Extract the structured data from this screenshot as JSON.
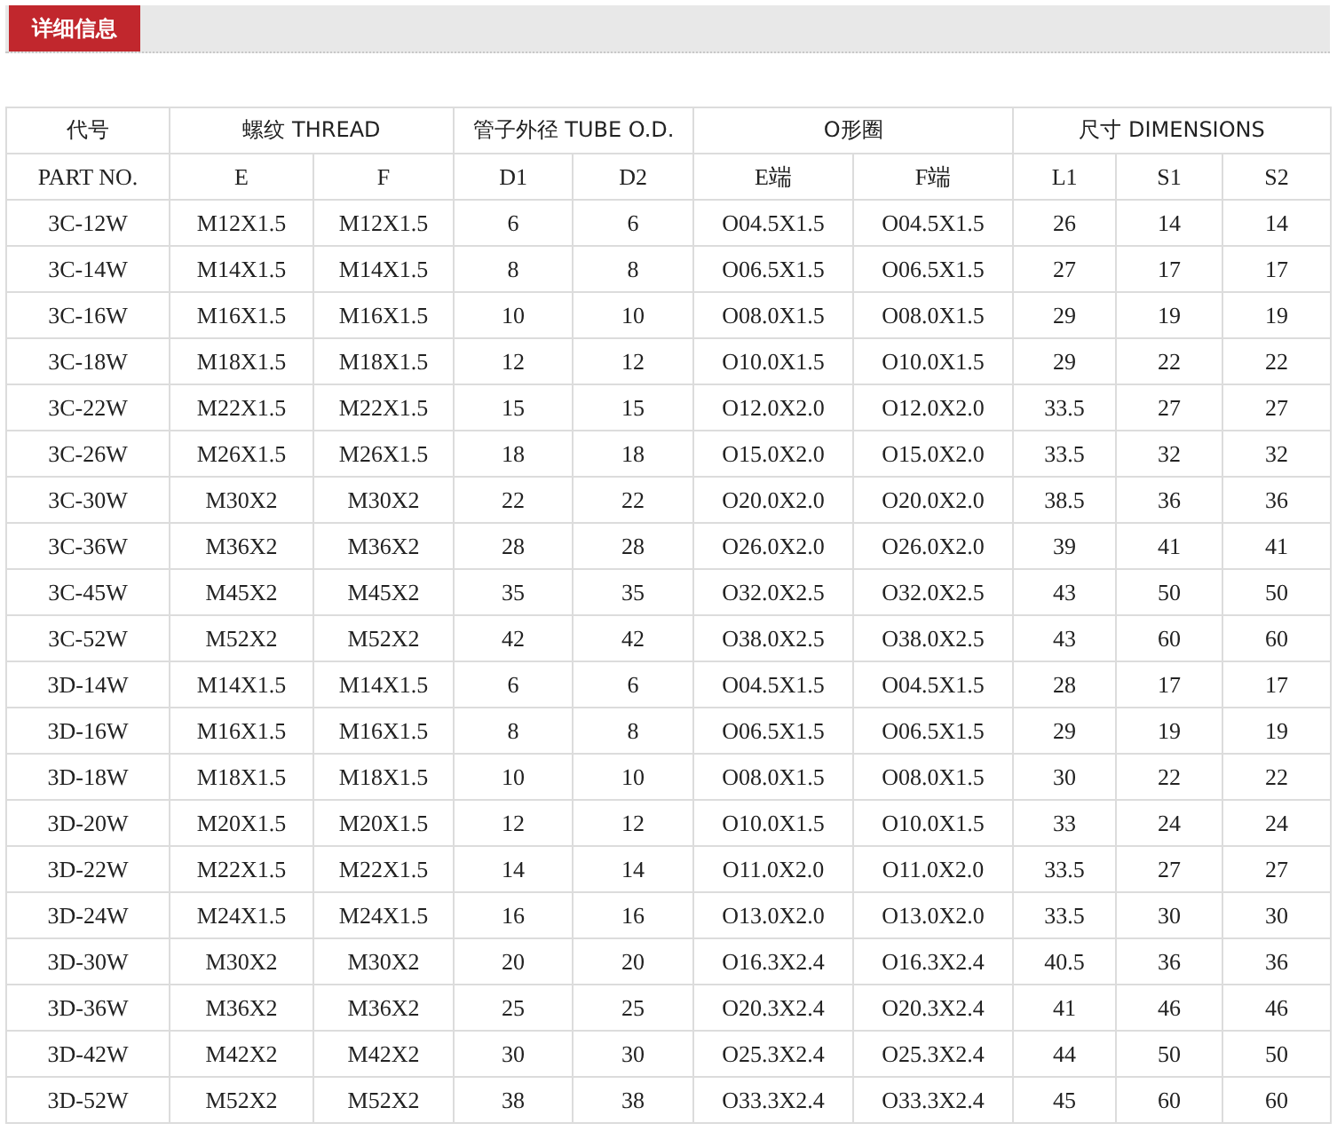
{
  "tabs": [
    {
      "label": "详细信息",
      "selected": true
    }
  ],
  "table": {
    "column_groups": [
      {
        "label": "代号",
        "columns": [
          "PART NO."
        ]
      },
      {
        "label": "螺纹 THREAD",
        "columns": [
          "E",
          "F"
        ]
      },
      {
        "label": "管子外径 TUBE O.D.",
        "columns": [
          "D1",
          "D2"
        ]
      },
      {
        "label": "O形圈",
        "columns": [
          "E端",
          "F端"
        ]
      },
      {
        "label": "尺寸 DIMENSIONS",
        "columns": [
          "L1",
          "S1",
          "S2"
        ]
      }
    ],
    "rows": [
      [
        "3C-12W",
        "M12X1.5",
        "M12X1.5",
        "6",
        "6",
        "O04.5X1.5",
        "O04.5X1.5",
        "26",
        "14",
        "14"
      ],
      [
        "3C-14W",
        "M14X1.5",
        "M14X1.5",
        "8",
        "8",
        "O06.5X1.5",
        "O06.5X1.5",
        "27",
        "17",
        "17"
      ],
      [
        "3C-16W",
        "M16X1.5",
        "M16X1.5",
        "10",
        "10",
        "O08.0X1.5",
        "O08.0X1.5",
        "29",
        "19",
        "19"
      ],
      [
        "3C-18W",
        "M18X1.5",
        "M18X1.5",
        "12",
        "12",
        "O10.0X1.5",
        "O10.0X1.5",
        "29",
        "22",
        "22"
      ],
      [
        "3C-22W",
        "M22X1.5",
        "M22X1.5",
        "15",
        "15",
        "O12.0X2.0",
        "O12.0X2.0",
        "33.5",
        "27",
        "27"
      ],
      [
        "3C-26W",
        "M26X1.5",
        "M26X1.5",
        "18",
        "18",
        "O15.0X2.0",
        "O15.0X2.0",
        "33.5",
        "32",
        "32"
      ],
      [
        "3C-30W",
        "M30X2",
        "M30X2",
        "22",
        "22",
        "O20.0X2.0",
        "O20.0X2.0",
        "38.5",
        "36",
        "36"
      ],
      [
        "3C-36W",
        "M36X2",
        "M36X2",
        "28",
        "28",
        "O26.0X2.0",
        "O26.0X2.0",
        "39",
        "41",
        "41"
      ],
      [
        "3C-45W",
        "M45X2",
        "M45X2",
        "35",
        "35",
        "O32.0X2.5",
        "O32.0X2.5",
        "43",
        "50",
        "50"
      ],
      [
        "3C-52W",
        "M52X2",
        "M52X2",
        "42",
        "42",
        "O38.0X2.5",
        "O38.0X2.5",
        "43",
        "60",
        "60"
      ],
      [
        "3D-14W",
        "M14X1.5",
        "M14X1.5",
        "6",
        "6",
        "O04.5X1.5",
        "O04.5X1.5",
        "28",
        "17",
        "17"
      ],
      [
        "3D-16W",
        "M16X1.5",
        "M16X1.5",
        "8",
        "8",
        "O06.5X1.5",
        "O06.5X1.5",
        "29",
        "19",
        "19"
      ],
      [
        "3D-18W",
        "M18X1.5",
        "M18X1.5",
        "10",
        "10",
        "O08.0X1.5",
        "O08.0X1.5",
        "30",
        "22",
        "22"
      ],
      [
        "3D-20W",
        "M20X1.5",
        "M20X1.5",
        "12",
        "12",
        "O10.0X1.5",
        "O10.0X1.5",
        "33",
        "24",
        "24"
      ],
      [
        "3D-22W",
        "M22X1.5",
        "M22X1.5",
        "14",
        "14",
        "O11.0X2.0",
        "O11.0X2.0",
        "33.5",
        "27",
        "27"
      ],
      [
        "3D-24W",
        "M24X1.5",
        "M24X1.5",
        "16",
        "16",
        "O13.0X2.0",
        "O13.0X2.0",
        "33.5",
        "30",
        "30"
      ],
      [
        "3D-30W",
        "M30X2",
        "M30X2",
        "20",
        "20",
        "O16.3X2.4",
        "O16.3X2.4",
        "40.5",
        "36",
        "36"
      ],
      [
        "3D-36W",
        "M36X2",
        "M36X2",
        "25",
        "25",
        "O20.3X2.4",
        "O20.3X2.4",
        "41",
        "46",
        "46"
      ],
      [
        "3D-42W",
        "M42X2",
        "M42X2",
        "30",
        "30",
        "O25.3X2.4",
        "O25.3X2.4",
        "44",
        "50",
        "50"
      ],
      [
        "3D-52W",
        "M52X2",
        "M52X2",
        "38",
        "38",
        "O33.3X2.4",
        "O33.3X2.4",
        "45",
        "60",
        "60"
      ]
    ]
  }
}
